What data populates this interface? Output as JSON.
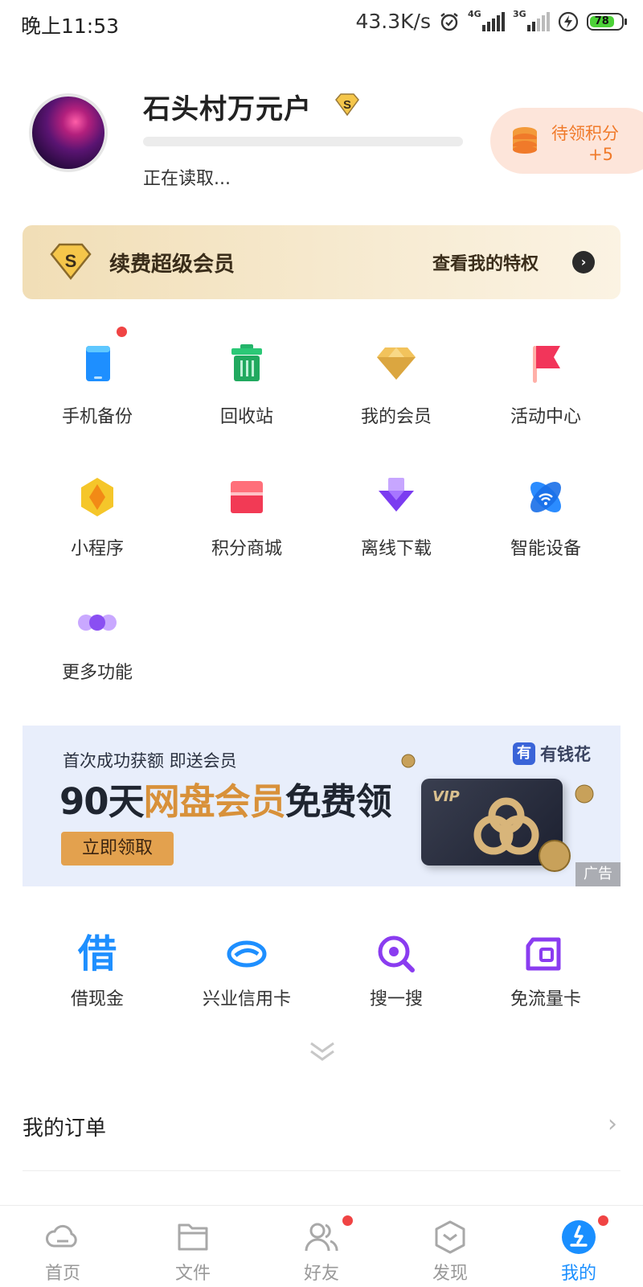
{
  "status_bar": {
    "time": "晚上11:53",
    "speed": "43.3K/s",
    "network1": "4G",
    "network2": "3G",
    "battery": "78"
  },
  "profile": {
    "username": "石头村万元户",
    "loading_text": "正在读取...",
    "points_label": "待领积分",
    "points_value": "+5"
  },
  "vip_banner": {
    "renew_label": "续费超级会员",
    "view_label": "查看我的特权"
  },
  "features": [
    {
      "label": "手机备份",
      "icon": "phone-backup-icon",
      "badge": true
    },
    {
      "label": "回收站",
      "icon": "recycle-bin-icon",
      "badge": false
    },
    {
      "label": "我的会员",
      "icon": "diamond-icon",
      "badge": false
    },
    {
      "label": "活动中心",
      "icon": "flag-icon",
      "badge": false
    },
    {
      "label": "小程序",
      "icon": "mini-program-icon",
      "badge": false
    },
    {
      "label": "积分商城",
      "icon": "store-icon",
      "badge": false
    },
    {
      "label": "离线下载",
      "icon": "download-arrow-icon",
      "badge": false
    },
    {
      "label": "智能设备",
      "icon": "smart-device-icon",
      "badge": false
    },
    {
      "label": "更多功能",
      "icon": "more-dots-icon",
      "badge": false
    }
  ],
  "ad": {
    "subtitle": "首次成功获额 即送会员",
    "headline_pre": "90天",
    "headline_highlight": "网盘会员",
    "headline_post": "免费领",
    "cta": "立即领取",
    "brand": "有钱花",
    "brand_icon_char": "有",
    "card_text": "VIP",
    "tag": "广告"
  },
  "services": [
    {
      "label": "借现金",
      "icon": "borrow-icon",
      "glyph": "借"
    },
    {
      "label": "兴业信用卡",
      "icon": "credit-card-icon"
    },
    {
      "label": "搜一搜",
      "icon": "search-icon"
    },
    {
      "label": "免流量卡",
      "icon": "data-card-icon"
    }
  ],
  "order": {
    "label": "我的订单"
  },
  "tabs": [
    {
      "label": "首页",
      "icon": "cloud-icon",
      "active": false,
      "badge": false
    },
    {
      "label": "文件",
      "icon": "folder-icon",
      "active": false,
      "badge": false
    },
    {
      "label": "好友",
      "icon": "friends-icon",
      "active": false,
      "badge": true
    },
    {
      "label": "发现",
      "icon": "discover-icon",
      "active": false,
      "badge": false
    },
    {
      "label": "我的",
      "icon": "profile-icon",
      "active": true,
      "badge": true
    }
  ],
  "colors": {
    "accent": "#1a8fff",
    "points": "#f07a2a",
    "gold": "#d8913a",
    "badge": "#f04444"
  }
}
